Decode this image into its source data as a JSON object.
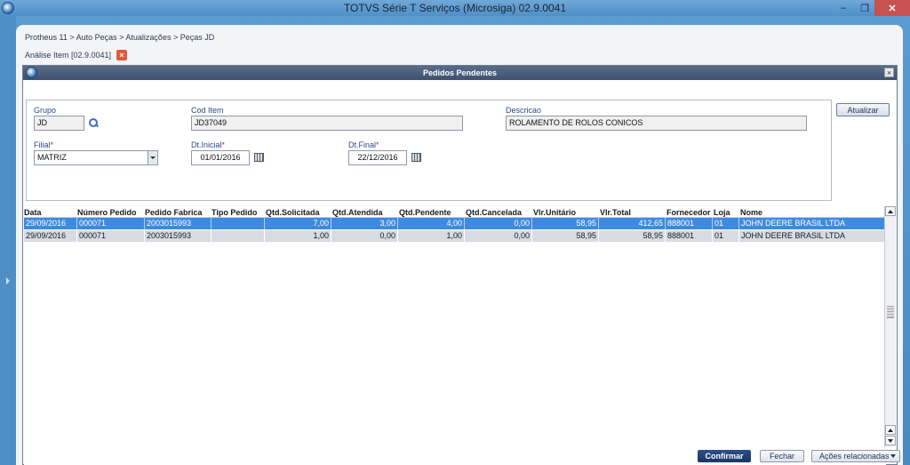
{
  "window": {
    "title": "TOTVS Série T Serviços (Microsiga) 02.9.0041",
    "minimize": "‒",
    "maximize": "❐",
    "close": "✕"
  },
  "breadcrumb": "Protheus 11 > Auto Peças > Atualizações > Peças JD",
  "tab": {
    "label": "Análise Item [02.9.0041]",
    "close": "×"
  },
  "dialog": {
    "title": "Pedidos Pendentes",
    "close": "×",
    "fields": {
      "grupo": {
        "label": "Grupo",
        "value": "JD"
      },
      "cod_item": {
        "label": "Cod Item",
        "value": "JD37049"
      },
      "descricao": {
        "label": "Descricao",
        "value": "ROLAMENTO DE ROLOS CONICOS"
      },
      "filial": {
        "label": "Filial",
        "required": "*",
        "value": "MATRIZ"
      },
      "dt_inicial": {
        "label": "Dt.Inicial",
        "required": "*",
        "value": "01/01/2016"
      },
      "dt_final": {
        "label": "Dt.Final",
        "required": "*",
        "value": "22/12/2016"
      }
    },
    "update_button": "Atualizar"
  },
  "grid": {
    "columns": [
      "Data",
      "Número Pedido",
      "Pedido Fabrica",
      "Tipo Pedido",
      "Qtd.Solicitada",
      "Qtd.Atendida",
      "Qtd.Pendente",
      "Qtd.Cancelada",
      "Vlr.Unitário",
      "Vlr.Total",
      "Fornecedor",
      "Loja",
      "Nome"
    ],
    "rows": [
      [
        "29/09/2016",
        "000071",
        "2003015993",
        "",
        "7,00",
        "3,00",
        "4,00",
        "0,00",
        "58,95",
        "412,65",
        "888001",
        "01",
        "JOHN DEERE BRASIL LTDA"
      ],
      [
        "29/09/2016",
        "000071",
        "2003015993",
        "",
        "1,00",
        "0,00",
        "1,00",
        "0,00",
        "58,95",
        "58,95",
        "888001",
        "01",
        "JOHN DEERE BRASIL LTDA"
      ]
    ]
  },
  "footer": {
    "confirm": "Confirmar",
    "close": "Fechar",
    "actions": "Ações relacionadas"
  },
  "colors": {
    "selected_row": "#3d8be0",
    "title_bar": "#5b9bd0",
    "dialog_header": "#4a5b7a"
  }
}
